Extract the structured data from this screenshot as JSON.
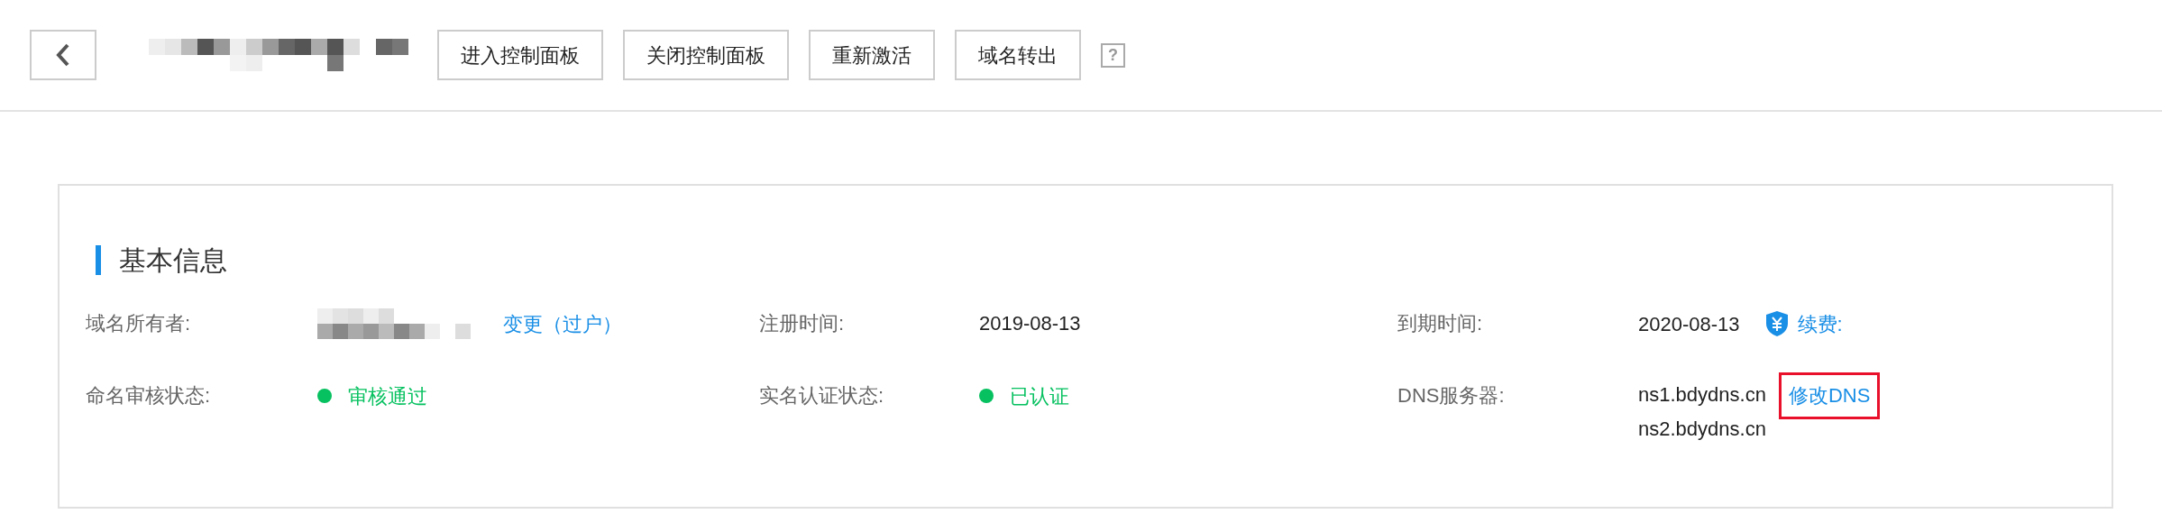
{
  "toolbar": {
    "buttons": [
      {
        "label": "进入控制面板"
      },
      {
        "label": "关闭控制面板"
      },
      {
        "label": "重新激活"
      },
      {
        "label": "域名转出"
      }
    ],
    "help": "?"
  },
  "basic_info": {
    "title": "基本信息",
    "fields": [
      {
        "label": "域名所有者:",
        "kind": "redacted",
        "link": "变更（过户）"
      },
      {
        "label": "注册时间:",
        "kind": "text",
        "value": "2019-08-13"
      },
      {
        "label": "到期时间:",
        "kind": "renew",
        "value": "2020-08-13",
        "link": "续费:"
      },
      {
        "label": "命名审核状态:",
        "kind": "status",
        "value": "审核通过",
        "color": "#07c160"
      },
      {
        "label": "实名认证状态:",
        "kind": "status",
        "value": "已认证",
        "color": "#07c160"
      },
      {
        "label": "DNS服务器:",
        "kind": "dns",
        "values": [
          "ns1.bdydns.cn",
          "ns2.bdydns.cn"
        ],
        "link": "修改DNS",
        "highlighted": true
      }
    ]
  }
}
